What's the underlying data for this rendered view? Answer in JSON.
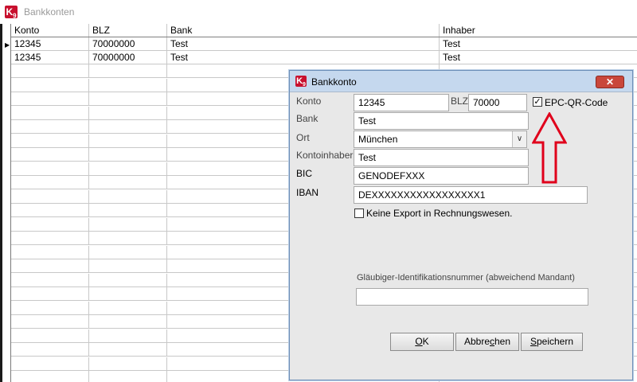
{
  "back_window": {
    "title": "Bankkonten",
    "icon_text": "K",
    "icon_sub": "9",
    "grid": {
      "columns": [
        "Konto",
        "BLZ",
        "Bank",
        "Inhaber"
      ],
      "rows": [
        [
          "12345",
          "70000000",
          "Test",
          "Test"
        ],
        [
          "12345",
          "70000000",
          "Test",
          "Test"
        ]
      ],
      "current_row_marker": "▶"
    }
  },
  "dialog": {
    "title": "Bankkonto",
    "icon_text": "K",
    "icon_sub": "9",
    "close_glyph": "✕",
    "fields": {
      "konto": {
        "label": "Konto",
        "value": "12345"
      },
      "blz": {
        "label": "BLZ",
        "value": "70000"
      },
      "epc": {
        "label": "EPC-QR-Code",
        "checked_glyph": "✓"
      },
      "bank": {
        "label": "Bank",
        "value": "Test"
      },
      "ort": {
        "label": "Ort",
        "value": "München",
        "dropdown_glyph": "∨"
      },
      "kontoinhaber": {
        "label": "Kontoinhaber",
        "value": "Test"
      },
      "bic": {
        "label": "BIC",
        "value": "GENODEFXXX"
      },
      "iban": {
        "label": "IBAN",
        "value": "DEXXXXXXXXXXXXXXXXX1"
      },
      "keine_export": {
        "label": "Keine Export in Rechnungswesen."
      },
      "glaeubiger": {
        "label": "Gläubiger-Identifikationsnummer (abweichend Mandant)",
        "value": ""
      }
    },
    "buttons": {
      "ok": {
        "mnemonic": "O",
        "rest": "K"
      },
      "abbrechen": {
        "before": "Abbre",
        "mnemonic": "c",
        "after": "hen"
      },
      "speichern": {
        "mnemonic": "S",
        "rest": "peichern"
      }
    },
    "annotation_color": "#e0001b"
  }
}
